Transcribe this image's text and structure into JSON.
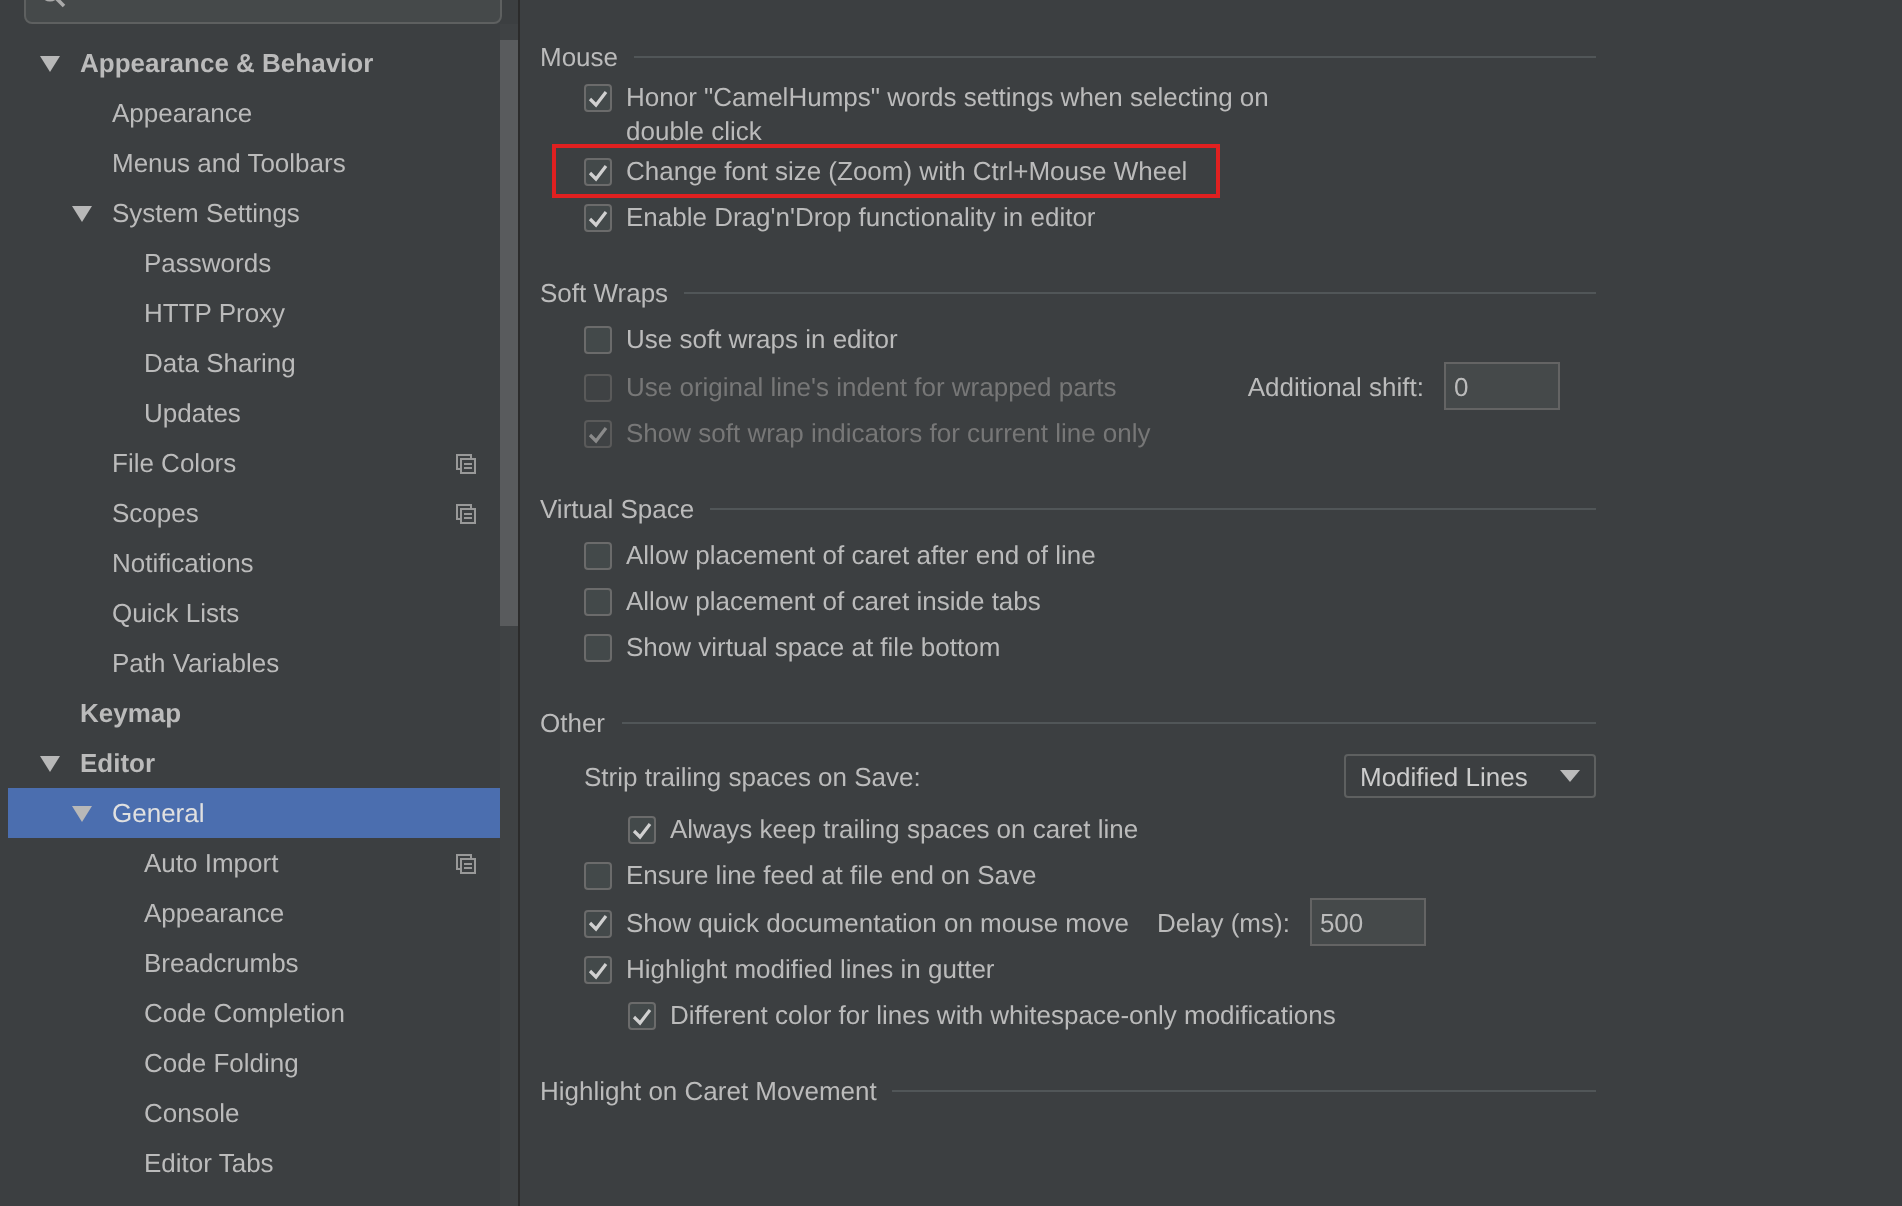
{
  "sidebar": {
    "tree": [
      {
        "label": "Appearance & Behavior",
        "bold": true,
        "expanded": true,
        "selected": false,
        "children": [
          {
            "label": "Appearance",
            "selected": false
          },
          {
            "label": "Menus and Toolbars",
            "selected": false
          },
          {
            "label": "System Settings",
            "expanded": true,
            "selected": false,
            "children": [
              {
                "label": "Passwords",
                "selected": false
              },
              {
                "label": "HTTP Proxy",
                "selected": false
              },
              {
                "label": "Data Sharing",
                "selected": false
              },
              {
                "label": "Updates",
                "selected": false
              }
            ]
          },
          {
            "label": "File Colors",
            "project_level": true,
            "selected": false
          },
          {
            "label": "Scopes",
            "project_level": true,
            "selected": false
          },
          {
            "label": "Notifications",
            "selected": false
          },
          {
            "label": "Quick Lists",
            "selected": false
          },
          {
            "label": "Path Variables",
            "selected": false
          }
        ]
      },
      {
        "label": "Keymap",
        "bold": true,
        "selected": false
      },
      {
        "label": "Editor",
        "bold": true,
        "expanded": true,
        "selected": false,
        "children": [
          {
            "label": "General",
            "expanded": true,
            "selected": true,
            "children": [
              {
                "label": "Auto Import",
                "project_level": true,
                "selected": false
              },
              {
                "label": "Appearance",
                "selected": false
              },
              {
                "label": "Breadcrumbs",
                "selected": false
              },
              {
                "label": "Code Completion",
                "selected": false
              },
              {
                "label": "Code Folding",
                "selected": false
              },
              {
                "label": "Console",
                "selected": false
              },
              {
                "label": "Editor Tabs",
                "selected": false
              }
            ]
          }
        ]
      }
    ]
  },
  "groups": [
    {
      "title": "Mouse",
      "items": [
        {
          "kind": "checkbox",
          "label": "Honor \"CamelHumps\" words settings when selecting on double click",
          "checked": true,
          "disabled": false
        },
        {
          "kind": "checkbox",
          "label": "Change font size (Zoom) with Ctrl+Mouse Wheel",
          "checked": true,
          "disabled": false,
          "highlighted": true
        },
        {
          "kind": "checkbox",
          "label": "Enable Drag'n'Drop functionality in editor",
          "checked": true,
          "disabled": false
        }
      ]
    },
    {
      "title": "Soft Wraps",
      "items": [
        {
          "kind": "checkbox",
          "label": "Use soft wraps in editor",
          "checked": false,
          "disabled": false
        },
        {
          "kind": "checkbox",
          "label": "Use original line's indent for wrapped parts",
          "checked": false,
          "disabled": true,
          "field": {
            "label": "Additional shift:",
            "value": "0"
          }
        },
        {
          "kind": "checkbox",
          "label": "Show soft wrap indicators for current line only",
          "checked": true,
          "disabled": true
        }
      ]
    },
    {
      "title": "Virtual Space",
      "items": [
        {
          "kind": "checkbox",
          "label": "Allow placement of caret after end of line",
          "checked": false,
          "disabled": false
        },
        {
          "kind": "checkbox",
          "label": "Allow placement of caret inside tabs",
          "checked": false,
          "disabled": false
        },
        {
          "kind": "checkbox",
          "label": "Show virtual space at file bottom",
          "checked": false,
          "disabled": false
        }
      ]
    },
    {
      "title": "Other",
      "items": [
        {
          "kind": "dropdown",
          "label": "Strip trailing spaces on Save:",
          "value": "Modified Lines",
          "children": [
            {
              "kind": "checkbox",
              "label": "Always keep trailing spaces on caret line",
              "checked": true,
              "disabled": false
            }
          ]
        },
        {
          "kind": "checkbox",
          "label": "Ensure line feed at file end on Save",
          "checked": false,
          "disabled": false
        },
        {
          "kind": "checkbox",
          "label": "Show quick documentation on mouse move",
          "checked": true,
          "disabled": false,
          "field": {
            "label": "Delay (ms):",
            "value": "500"
          }
        },
        {
          "kind": "checkbox",
          "label": "Highlight modified lines in gutter",
          "checked": true,
          "disabled": false,
          "children": [
            {
              "kind": "checkbox",
              "label": "Different color for lines with whitespace-only modifications",
              "checked": true,
              "disabled": false
            }
          ]
        }
      ]
    },
    {
      "title": "Highlight on Caret Movement"
    }
  ]
}
